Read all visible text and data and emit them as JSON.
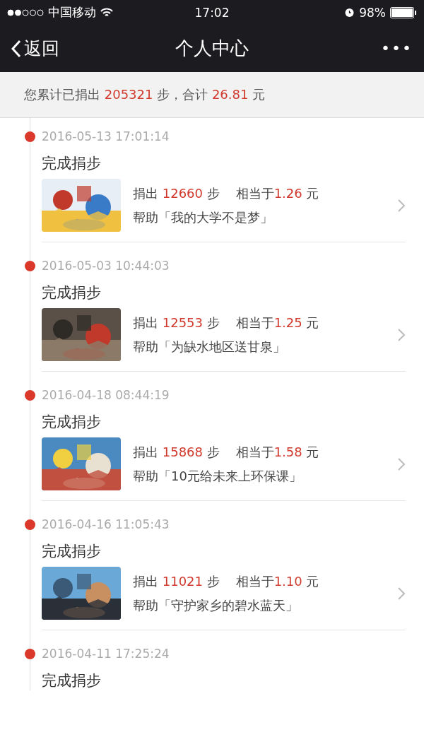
{
  "status_bar": {
    "carrier": "中国移动",
    "time": "17:02",
    "battery": "98%"
  },
  "nav": {
    "back": "返回",
    "title": "个人中心",
    "more": "•••"
  },
  "summary": [
    {
      "text": "您累计已捐出 ",
      "highlight": false
    },
    {
      "text": "205321",
      "highlight": true
    },
    {
      "text": " 步，合计 ",
      "highlight": false
    },
    {
      "text": "26.81",
      "highlight": true
    },
    {
      "text": " 元",
      "highlight": false
    }
  ],
  "entries": [
    {
      "time": "2016-05-13 17:01:14",
      "title": "完成捐步",
      "donated_label": "捐出",
      "steps": "12660",
      "steps_unit": "步",
      "equiv_label": "相当于",
      "amount": "1.26",
      "amount_unit": "元",
      "project": "帮助「我的大学不是梦」"
    },
    {
      "time": "2016-05-03 10:44:03",
      "title": "完成捐步",
      "donated_label": "捐出",
      "steps": "12553",
      "steps_unit": "步",
      "equiv_label": "相当于",
      "amount": "1.25",
      "amount_unit": "元",
      "project": "帮助「为缺水地区送甘泉」"
    },
    {
      "time": "2016-04-18 08:44:19",
      "title": "完成捐步",
      "donated_label": "捐出",
      "steps": "15868",
      "steps_unit": "步",
      "equiv_label": "相当于",
      "amount": "1.58",
      "amount_unit": "元",
      "project": "帮助「10元给未来上环保课」"
    },
    {
      "time": "2016-04-16 11:05:43",
      "title": "完成捐步",
      "donated_label": "捐出",
      "steps": "11021",
      "steps_unit": "步",
      "equiv_label": "相当于",
      "amount": "1.10",
      "amount_unit": "元",
      "project": "帮助「守护家乡的碧水蓝天」"
    },
    {
      "time": "2016-04-11 17:25:24",
      "title": "完成捐步"
    }
  ]
}
